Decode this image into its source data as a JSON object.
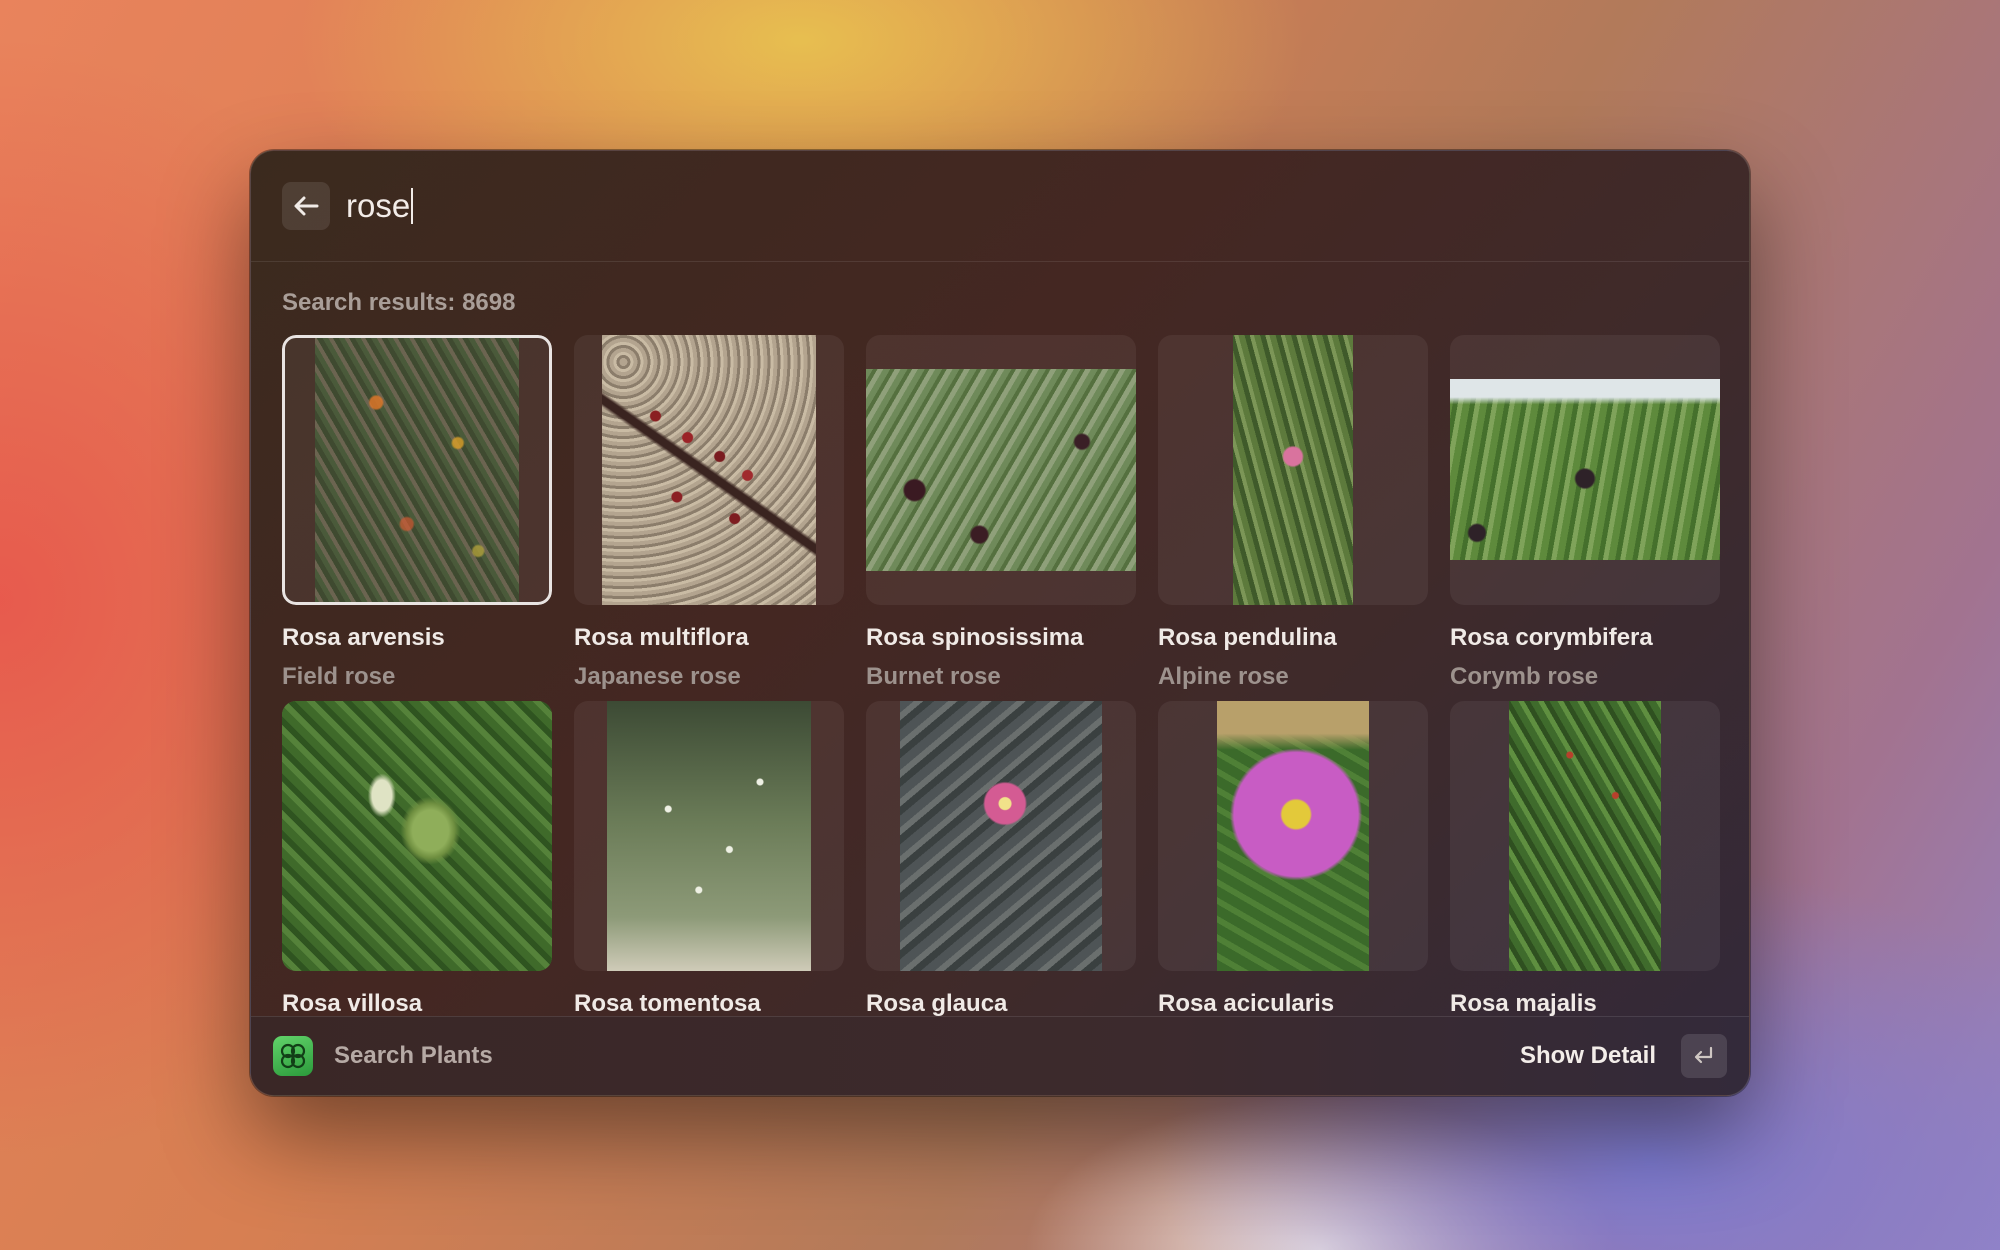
{
  "search": {
    "query": "rose",
    "back_icon": "arrow-left-icon"
  },
  "results": {
    "count_label": "Search results: 8698"
  },
  "plants": [
    {
      "latin": "Rosa arvensis",
      "common": "Field rose",
      "selected": true
    },
    {
      "latin": "Rosa multiflora",
      "common": "Japanese rose"
    },
    {
      "latin": "Rosa spinosissima",
      "common": "Burnet rose"
    },
    {
      "latin": "Rosa pendulina",
      "common": "Alpine rose"
    },
    {
      "latin": "Rosa corymbifera",
      "common": "Corymb rose"
    },
    {
      "latin": "Rosa villosa",
      "common": ""
    },
    {
      "latin": "Rosa tomentosa",
      "common": ""
    },
    {
      "latin": "Rosa glauca",
      "common": ""
    },
    {
      "latin": "Rosa acicularis",
      "common": ""
    },
    {
      "latin": "Rosa majalis",
      "common": ""
    }
  ],
  "footer": {
    "app_name": "Search Plants",
    "app_icon": "clover-icon",
    "action_label": "Show Detail",
    "enter_icon": "return-key-icon"
  }
}
